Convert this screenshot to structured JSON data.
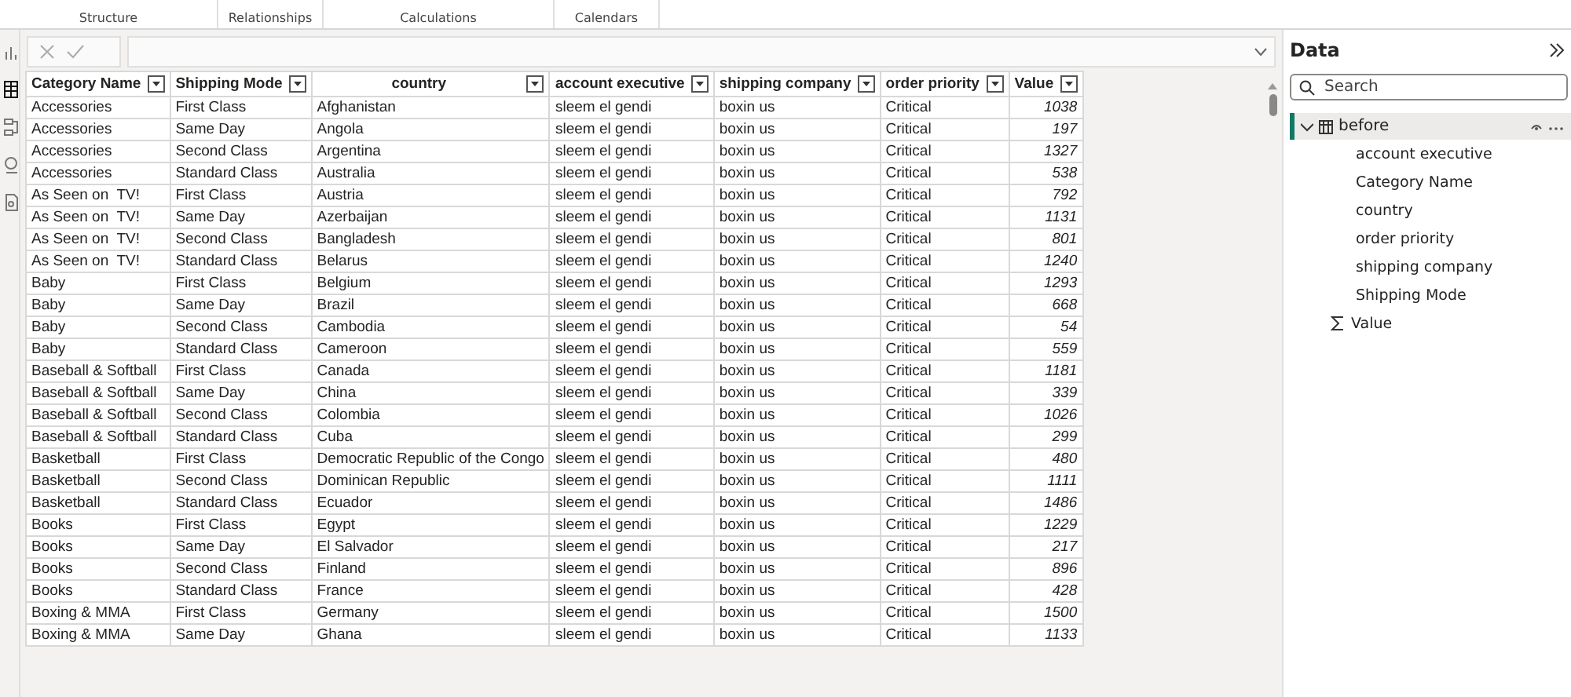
{
  "ribbon": {
    "groups": [
      "Structure",
      "Relationships",
      "Calculations",
      "Calendars"
    ]
  },
  "rail": {
    "items": [
      {
        "kind": "report",
        "selected": false
      },
      {
        "kind": "table",
        "selected": true
      },
      {
        "kind": "model",
        "selected": false
      },
      {
        "kind": "dax",
        "selected": false
      },
      {
        "kind": "query",
        "selected": false
      }
    ]
  },
  "table": {
    "columns": [
      "Category Name",
      "Shipping Mode",
      "country",
      "account executive",
      "shipping company",
      "order priority",
      "Value"
    ],
    "rows": [
      [
        "Accessories",
        "First Class",
        "Afghanistan",
        "sleem el gendi",
        "boxin us",
        "Critical",
        "1038"
      ],
      [
        "Accessories",
        "Same Day",
        "Angola",
        "sleem el gendi",
        "boxin us",
        "Critical",
        "197"
      ],
      [
        "Accessories",
        "Second Class",
        "Argentina",
        "sleem el gendi",
        "boxin us",
        "Critical",
        "1327"
      ],
      [
        "Accessories",
        "Standard Class",
        "Australia",
        "sleem el gendi",
        "boxin us",
        "Critical",
        "538"
      ],
      [
        "As Seen on  TV!",
        "First Class",
        "Austria",
        "sleem el gendi",
        "boxin us",
        "Critical",
        "792"
      ],
      [
        "As Seen on  TV!",
        "Same Day",
        "Azerbaijan",
        "sleem el gendi",
        "boxin us",
        "Critical",
        "1131"
      ],
      [
        "As Seen on  TV!",
        "Second Class",
        "Bangladesh",
        "sleem el gendi",
        "boxin us",
        "Critical",
        "801"
      ],
      [
        "As Seen on  TV!",
        "Standard Class",
        "Belarus",
        "sleem el gendi",
        "boxin us",
        "Critical",
        "1240"
      ],
      [
        "Baby",
        "First Class",
        "Belgium",
        "sleem el gendi",
        "boxin us",
        "Critical",
        "1293"
      ],
      [
        "Baby",
        "Same Day",
        "Brazil",
        "sleem el gendi",
        "boxin us",
        "Critical",
        "668"
      ],
      [
        "Baby",
        "Second Class",
        "Cambodia",
        "sleem el gendi",
        "boxin us",
        "Critical",
        "54"
      ],
      [
        "Baby",
        "Standard Class",
        "Cameroon",
        "sleem el gendi",
        "boxin us",
        "Critical",
        "559"
      ],
      [
        "Baseball & Softball",
        "First Class",
        "Canada",
        "sleem el gendi",
        "boxin us",
        "Critical",
        "1181"
      ],
      [
        "Baseball & Softball",
        "Same Day",
        "China",
        "sleem el gendi",
        "boxin us",
        "Critical",
        "339"
      ],
      [
        "Baseball & Softball",
        "Second Class",
        "Colombia",
        "sleem el gendi",
        "boxin us",
        "Critical",
        "1026"
      ],
      [
        "Baseball & Softball",
        "Standard Class",
        "Cuba",
        "sleem el gendi",
        "boxin us",
        "Critical",
        "299"
      ],
      [
        "Basketball",
        "First Class",
        "Democratic Republic of the Congo",
        "sleem el gendi",
        "boxin us",
        "Critical",
        "480"
      ],
      [
        "Basketball",
        "Second Class",
        "Dominican Republic",
        "sleem el gendi",
        "boxin us",
        "Critical",
        "1111"
      ],
      [
        "Basketball",
        "Standard Class",
        "Ecuador",
        "sleem el gendi",
        "boxin us",
        "Critical",
        "1486"
      ],
      [
        "Books",
        "First Class",
        "Egypt",
        "sleem el gendi",
        "boxin us",
        "Critical",
        "1229"
      ],
      [
        "Books",
        "Same Day",
        "El Salvador",
        "sleem el gendi",
        "boxin us",
        "Critical",
        "217"
      ],
      [
        "Books",
        "Second Class",
        "Finland",
        "sleem el gendi",
        "boxin us",
        "Critical",
        "896"
      ],
      [
        "Books",
        "Standard Class",
        "France",
        "sleem el gendi",
        "boxin us",
        "Critical",
        "428"
      ],
      [
        "Boxing & MMA",
        "First Class",
        "Germany",
        "sleem el gendi",
        "boxin us",
        "Critical",
        "1500"
      ],
      [
        "Boxing & MMA",
        "Same Day",
        "Ghana",
        "sleem el gendi",
        "boxin us",
        "Critical",
        "1133"
      ]
    ]
  },
  "data_pane": {
    "title": "Data",
    "search": {
      "placeholder": "Search"
    },
    "tables": [
      {
        "name": "before",
        "expanded": true,
        "selected": true,
        "fields": [
          {
            "name": "account executive",
            "kind": "text"
          },
          {
            "name": "Category Name",
            "kind": "text"
          },
          {
            "name": "country",
            "kind": "text"
          },
          {
            "name": "order priority",
            "kind": "text"
          },
          {
            "name": "shipping company",
            "kind": "text"
          },
          {
            "name": "Shipping Mode",
            "kind": "text"
          },
          {
            "name": "Value",
            "kind": "sum"
          }
        ]
      }
    ]
  }
}
